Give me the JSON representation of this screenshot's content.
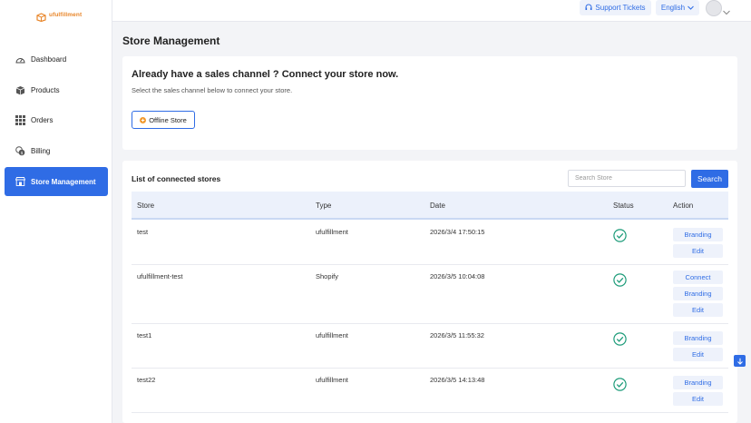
{
  "brand": {
    "name": "ufulfillment",
    "color": "#e8862a"
  },
  "colors": {
    "primary": "#2f6ce5",
    "success": "#1e9c7a",
    "offline": "#f29a2e"
  },
  "sidebar": {
    "items": [
      {
        "label": "Dashboard",
        "icon": "speedometer-icon",
        "active": false
      },
      {
        "label": "Products",
        "icon": "box-icon",
        "active": false
      },
      {
        "label": "Orders",
        "icon": "grid-icon",
        "active": false
      },
      {
        "label": "Billing",
        "icon": "coins-icon",
        "active": false
      },
      {
        "label": "Store Management",
        "icon": "store-icon",
        "active": true
      }
    ]
  },
  "topbar": {
    "support_label": "Support Tickets",
    "language_label": "English"
  },
  "page": {
    "title": "Store Management"
  },
  "connect_card": {
    "heading": "Already have a sales channel ? Connect your store now.",
    "subtext": "Select the sales channel below to connect your store.",
    "offline_label": "Offline Store"
  },
  "stores": {
    "title": "List of connected stores",
    "search_placeholder": "Search Store",
    "search_label": "Search",
    "columns": [
      "Store",
      "Type",
      "Date",
      "Status",
      "Action"
    ],
    "rows": [
      {
        "store": "test",
        "type": "ufulfillment",
        "date": "2026/3/4 17:50:15",
        "status": "connected",
        "actions": [
          "Branding",
          "Edit"
        ]
      },
      {
        "store": "ufulfillment-test",
        "type": "Shopify",
        "date": "2026/3/5 10:04:08",
        "status": "connected",
        "actions": [
          "Connect",
          "Branding",
          "Edit"
        ]
      },
      {
        "store": "test1",
        "type": "ufulfillment",
        "date": "2026/3/5 11:55:32",
        "status": "connected",
        "actions": [
          "Branding",
          "Edit"
        ]
      },
      {
        "store": "test22",
        "type": "ufulfillment",
        "date": "2026/3/5 14:13:48",
        "status": "connected",
        "actions": [
          "Branding",
          "Edit"
        ]
      }
    ]
  }
}
